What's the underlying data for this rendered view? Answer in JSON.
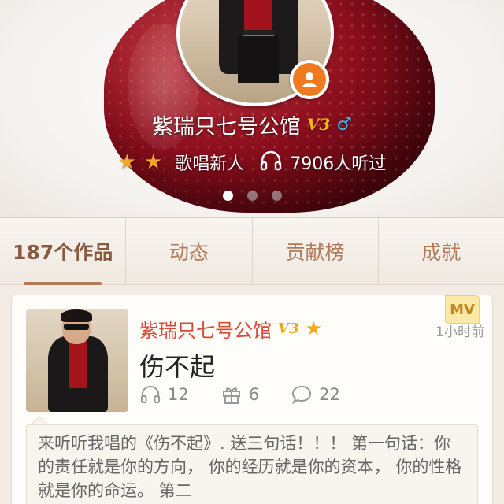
{
  "profile": {
    "name": "紫瑞只七号公馆",
    "vip_badge": "V3",
    "gender_symbol": "♂",
    "stars": 2,
    "level_title": "歌唱新人",
    "listen_count": "7906人听过",
    "carousel": {
      "pages": 3,
      "active_index": 0
    }
  },
  "tabs": [
    {
      "label": "187个作品",
      "active": true
    },
    {
      "label": "动态",
      "active": false
    },
    {
      "label": "贡献榜",
      "active": false
    },
    {
      "label": "成就",
      "active": false
    }
  ],
  "work_card": {
    "mv_label": "MV",
    "author": "紫瑞只七号公馆",
    "vip_badge": "V3",
    "time": "1小时前",
    "title": "伤不起",
    "listens": "12",
    "gifts": "6",
    "comments": "22",
    "description": "来听听我唱的《伤不起》. 送三句话！！！ 第一句话：你的责任就是你的方向， 你的经历就是你的资本， 你的性格就是你的命运。 第二"
  },
  "colors": {
    "accent_name": "#d84a38",
    "tab_text": "#b07a57",
    "star": "#f5a623",
    "gender": "#3fb4e8",
    "anchor_badge": "#f07a20"
  },
  "icons": [
    "user-icon",
    "headphones-icon",
    "gift-icon",
    "comment-icon",
    "star-icon",
    "male-icon"
  ]
}
